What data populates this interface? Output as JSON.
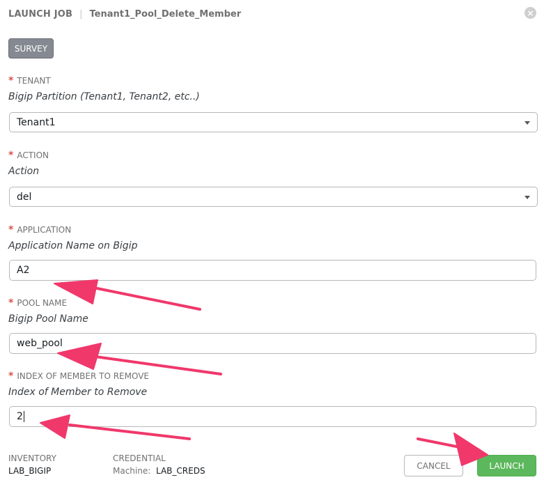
{
  "header": {
    "title": "LAUNCH JOB",
    "separator": "|",
    "job_name": "Tenant1_Pool_Delete_Member",
    "close_symbol": "×"
  },
  "tabs": {
    "survey_label": "SURVEY"
  },
  "required_marker": "*",
  "fields": {
    "tenant": {
      "label": "TENANT",
      "description": "Bigip Partition (Tenant1, Tenant2, etc..)",
      "value": "Tenant1"
    },
    "action": {
      "label": "ACTION",
      "description": "Action",
      "value": "del"
    },
    "application": {
      "label": "APPLICATION",
      "description": "Application Name on Bigip",
      "value": "A2"
    },
    "pool_name": {
      "label": "POOL NAME",
      "description": "Bigip Pool Name",
      "value": "web_pool"
    },
    "member_index": {
      "label": "INDEX OF MEMBER TO REMOVE",
      "description": "Index of Member to Remove",
      "value": "2"
    }
  },
  "footer": {
    "inventory_label": "INVENTORY",
    "inventory_value": "LAB_BIGIP",
    "credential_label": "CREDENTIAL",
    "credential_type": "Machine:",
    "credential_value": "LAB_CREDS"
  },
  "buttons": {
    "cancel_label": "CANCEL",
    "launch_label": "LAUNCH"
  },
  "colors": {
    "required": "#d9534f",
    "launch": "#5cb85c",
    "survey_tab": "#848992",
    "annotation_arrow": "#f0386b"
  }
}
